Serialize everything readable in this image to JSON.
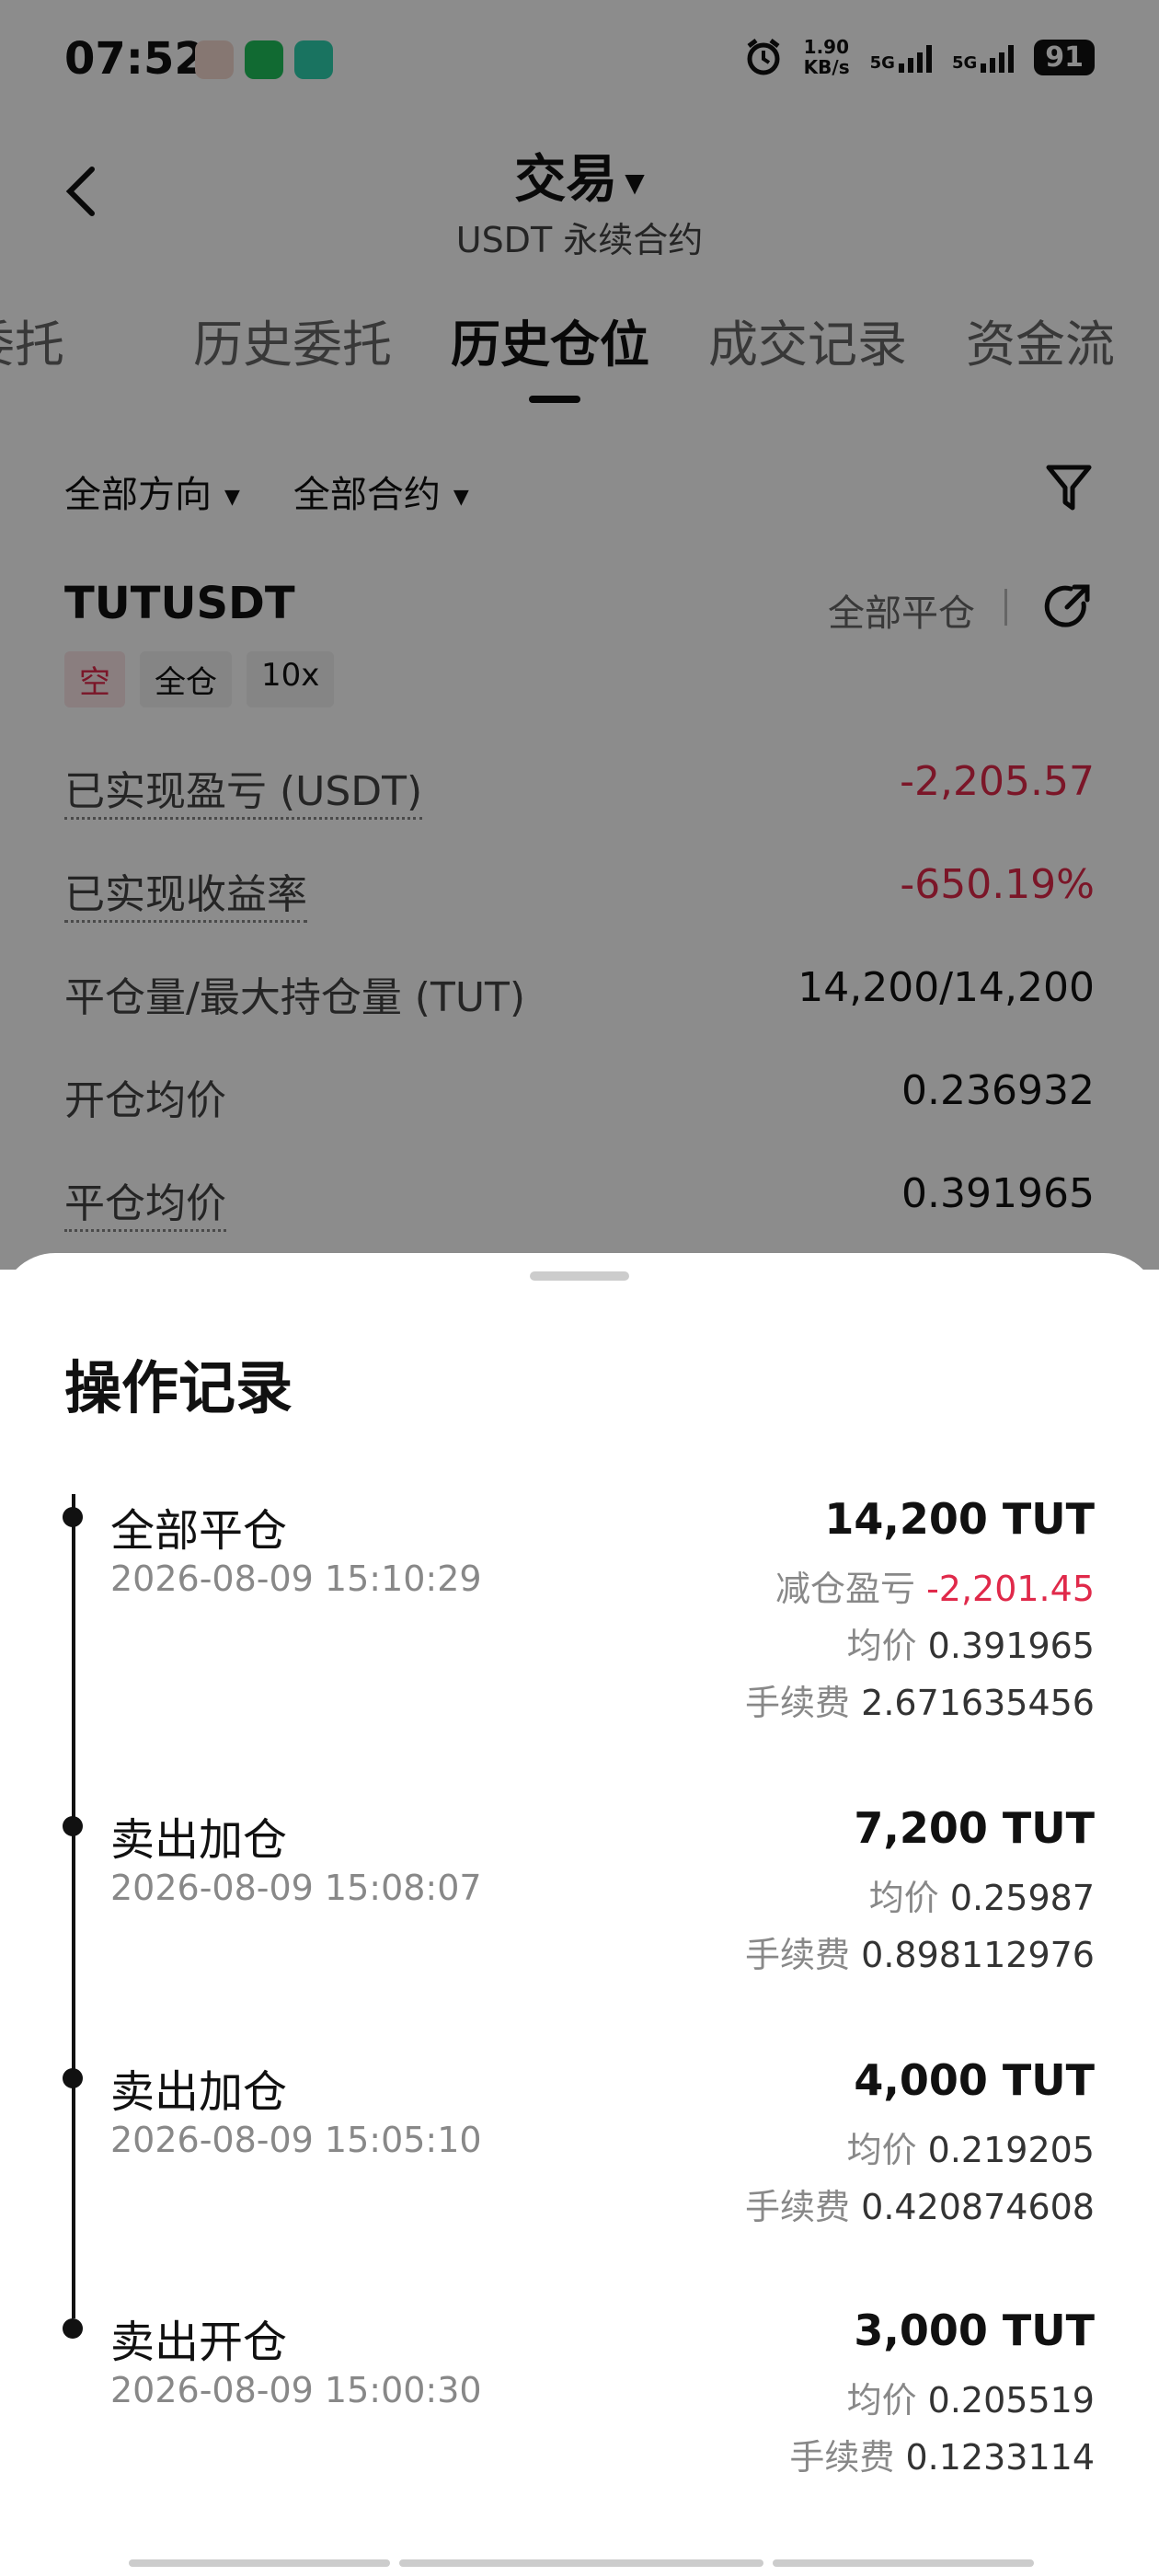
{
  "status": {
    "time": "07:52",
    "net_speed": "1.90",
    "net_unit": "KB/s",
    "sig1": "5G",
    "sig2": "5G",
    "battery": "91"
  },
  "header": {
    "title": "交易",
    "subtitle": "USDT 永续合约"
  },
  "tabs": [
    "委托",
    "历史委托",
    "历史仓位",
    "成交记录",
    "资金流"
  ],
  "filters": {
    "direction": "全部方向",
    "contract": "全部合约"
  },
  "position": {
    "symbol": "TUTUSDT",
    "close_all_label": "全部平仓",
    "tags": [
      "空",
      "全仓",
      "10x"
    ],
    "rows": [
      {
        "label": "已实现盈亏 (USDT)",
        "value": "-2,205.57"
      },
      {
        "label": "已实现收益率",
        "value": "-650.19%"
      },
      {
        "label": "平仓量/最大持仓量 (TUT)",
        "value": "14,200/14,200"
      },
      {
        "label": "开仓均价",
        "value": "0.236932"
      },
      {
        "label": "平仓均价",
        "value": "0.391965"
      }
    ]
  },
  "sheet": {
    "title": "操作记录",
    "records": [
      {
        "action": "全部平仓",
        "time": "2026-08-09 15:10:29",
        "qty": "14,200 TUT",
        "pnl_label": "减仓盈亏",
        "pnl_value": "-2,201.45",
        "avg_label": "均价",
        "avg_value": "0.391965",
        "fee_label": "手续费",
        "fee_value": "2.671635456"
      },
      {
        "action": "卖出加仓",
        "time": "2026-08-09 15:08:07",
        "qty": "7,200 TUT",
        "avg_label": "均价",
        "avg_value": "0.25987",
        "fee_label": "手续费",
        "fee_value": "0.898112976"
      },
      {
        "action": "卖出加仓",
        "time": "2026-08-09 15:05:10",
        "qty": "4,000 TUT",
        "avg_label": "均价",
        "avg_value": "0.219205",
        "fee_label": "手续费",
        "fee_value": "0.420874608"
      },
      {
        "action": "卖出开仓",
        "time": "2026-08-09 15:00:30",
        "qty": "3,000 TUT",
        "avg_label": "均价",
        "avg_value": "0.205519",
        "fee_label": "手续费",
        "fee_value": "0.1233114"
      }
    ]
  },
  "colors": {
    "negative": "#e0294a",
    "overlay": "rgba(0,0,0,0.45)"
  }
}
